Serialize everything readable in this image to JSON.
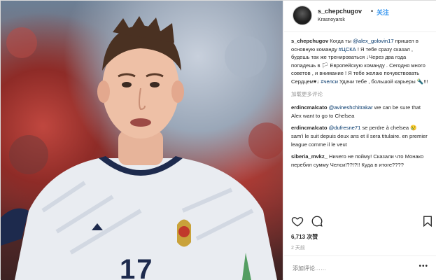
{
  "post": {
    "username": "s_chepchugov",
    "separator": "•",
    "follow_label": "关注",
    "location": "Krasnoyarsk",
    "caption": {
      "user": "s_chepchugov",
      "t1": " Когда ты ",
      "mention": "@alex_golovin17",
      "t2": " пришел в основную команду ",
      "hashtag": "#ЦСКА",
      "t3": " ! Я тебе сразу сказал , будешь так же тренироваться ↓Через два года попадешь в 🏳 Европейскую команду . Сегодня много советов , и внимание ! Я тебе желаю почувствовать Сердцем♥↓ ",
      "hashtag2": "#челси",
      "t4": " Удачи тебе , большой карьеры 🔦!!!"
    },
    "load_more": "加载更多评论",
    "comments": [
      {
        "user": "erdincmalcato",
        "mention": "@avineshchitrakar",
        "text": " we can be sure that Alex want to go to Chelsea"
      },
      {
        "user": "erdincmalcato",
        "mention": "@dufresne71",
        "text": " se perdre à chelsea 😢 sam'i le suit depuis deux ans et il sera titulaire. en premier league comme il le veut"
      },
      {
        "user": "siberia_mvkz_",
        "mention": "",
        "text": " Ничего не пойму! Сказали что Монако перебил сумму Челси!??!?!! Куда в итоге????"
      }
    ],
    "likes": "6,713 次赞",
    "time": "2 天前",
    "add_comment_placeholder": "添加评论……",
    "more_label": "•••",
    "jersey_number": "17"
  },
  "icons": {
    "like": "heart-icon",
    "comment": "comment-icon",
    "save": "bookmark-icon",
    "more": "more-icon"
  }
}
